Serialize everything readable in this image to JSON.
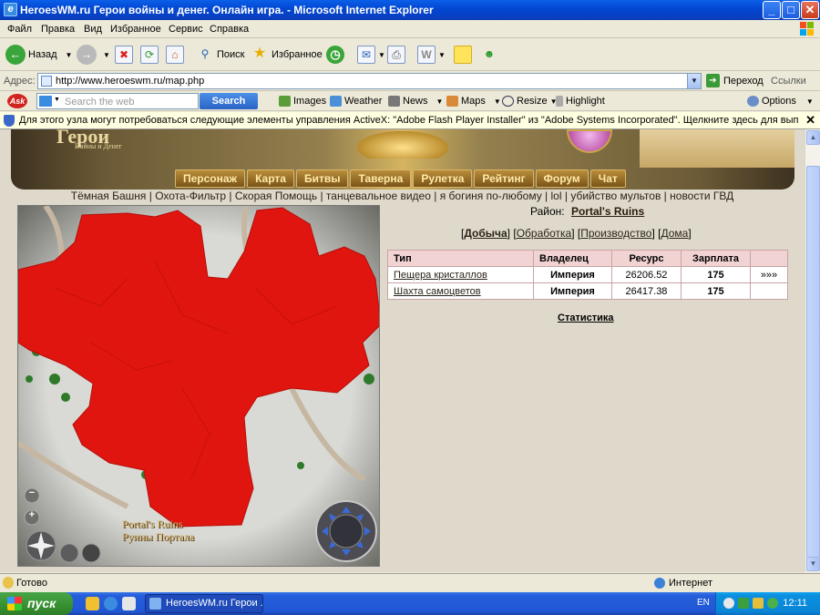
{
  "window": {
    "title": "HeroesWM.ru Герои войны и денег. Онлайн игра. - Microsoft Internet Explorer",
    "min_label": "_",
    "max_label": "□",
    "close_label": "✕"
  },
  "menu": [
    "Файл",
    "Правка",
    "Вид",
    "Избранное",
    "Сервис",
    "Справка"
  ],
  "toolbar": {
    "back": "Назад",
    "search": "Поиск",
    "favorites": "Избранное"
  },
  "address": {
    "label": "Адрес:",
    "url": "http://www.heroeswm.ru/map.php",
    "go": "Переход",
    "links": "Ссылки"
  },
  "ask": {
    "logo": "Ask",
    "placeholder": "Search the web",
    "search_button": "Search",
    "items": [
      "Images",
      "Weather",
      "News",
      "Maps",
      "Resize",
      "Highlight",
      "Options"
    ]
  },
  "infobar": {
    "text": "Для этого узла могут потребоваться следующие элементы управления ActiveX: \"Adobe Flash Player Installer\" из \"Adobe Systems Incorporated\". Щелкните здесь для выполнения установки..."
  },
  "site": {
    "logo_text": "Герои",
    "logo_sub": "Войны и Денег",
    "nav": [
      "Персонаж",
      "Карта",
      "Битвы",
      "Таверна",
      "Рулетка",
      "Рейтинг",
      "Форум",
      "Чат"
    ],
    "links": [
      "Тёмная Башня",
      "Охота-Фильтр",
      "Скорая Помощь",
      "танцевальное видео",
      "я богиня по-любому",
      "lol",
      "убийство мультов",
      "новости ГВД"
    ]
  },
  "map": {
    "label_en": "Portal's Ruins",
    "label_ru": "Руины Портала",
    "zoom_out": "−",
    "zoom_in": "+"
  },
  "region": {
    "label": "Район:",
    "name": "Portal's Ruins"
  },
  "tabs": [
    {
      "label": "Добыча",
      "active": true
    },
    {
      "label": "Обработка",
      "active": false
    },
    {
      "label": "Производство",
      "active": false
    },
    {
      "label": "Дома",
      "active": false
    }
  ],
  "table": {
    "headers": [
      "Тип",
      "Владелец",
      "Ресурс",
      "Зарплата",
      ""
    ],
    "rows": [
      {
        "type": "Пещера кристаллов",
        "owner": "Империя",
        "resource": "26206.52",
        "salary": "175",
        "extra": "»»»"
      },
      {
        "type": "Шахта самоцветов",
        "owner": "Империя",
        "resource": "26417.38",
        "salary": "175",
        "extra": ""
      }
    ]
  },
  "stats_link": "Статистика",
  "status": {
    "text": "Готово",
    "zone": "Интернет"
  },
  "taskbar": {
    "start": "пуск",
    "task": "HeroesWM.ru Герои ...",
    "lang": "EN",
    "clock": "12:11"
  },
  "colors": {
    "map_red": "#e0150f",
    "title_blue": "#0346d1",
    "start_green": "#37902f"
  }
}
